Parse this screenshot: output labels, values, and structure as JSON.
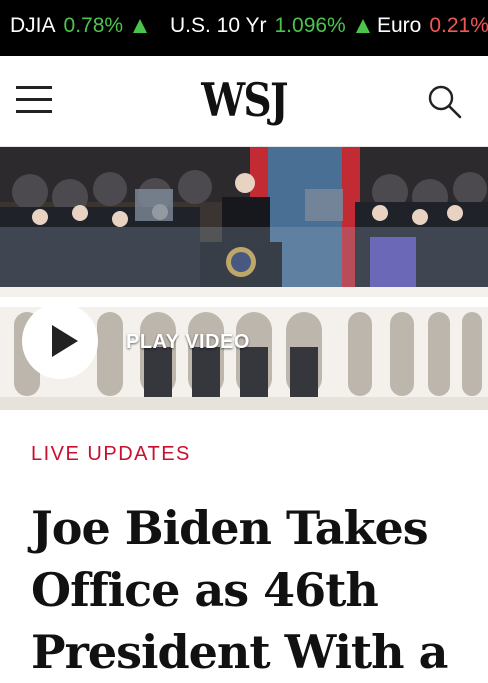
{
  "ticker": [
    {
      "name": "DJIA",
      "value": "0.78%",
      "direction": "up"
    },
    {
      "name": "U.S. 10 Yr",
      "value": "1.096%",
      "direction": "up"
    },
    {
      "name": "Euro",
      "value": "0.21%",
      "direction": "down"
    }
  ],
  "colors": {
    "up": "#4cc44c",
    "down": "#f25757",
    "kicker": "#c8102e"
  },
  "header": {
    "logo": "WSJ",
    "menu_icon": "hamburger-menu-icon",
    "search_icon": "search-icon"
  },
  "hero": {
    "play_label": "PLAY VIDEO"
  },
  "article": {
    "kicker": "LIVE UPDATES",
    "headline_lines": [
      "Joe Biden Takes",
      "Office as 46th",
      "President With a"
    ]
  }
}
